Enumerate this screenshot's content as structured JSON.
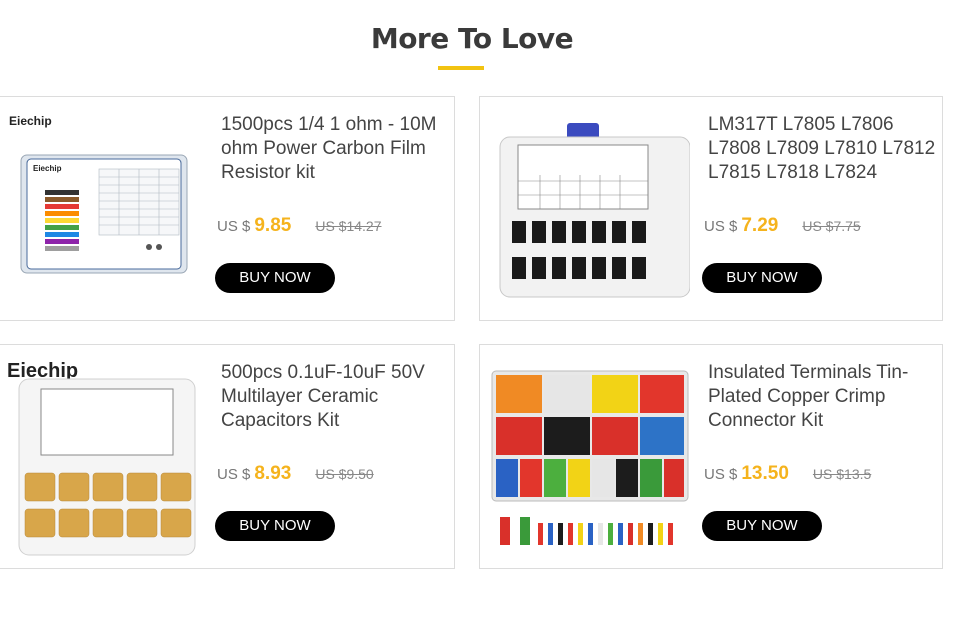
{
  "section": {
    "title": "More To Love",
    "accent": "#f2c311"
  },
  "products": [
    {
      "name": "1500pcs 1/4 1 ohm - 10M ohm Power Carbon Film Resistor kit",
      "currency": "US $",
      "price": "9.85",
      "old_price": "US $14.27",
      "button": "BUY NOW",
      "brand": "Eiechip"
    },
    {
      "name": "LM317T L7805 L7806 L7808 L7809 L7810 L7812 L7815 L7818 L7824",
      "currency": "US $",
      "price": "7.29",
      "old_price": "US $7.75",
      "button": "BUY NOW"
    },
    {
      "name": "500pcs 0.1uF-10uF 50V Multilayer Ceramic Capacitors Kit",
      "currency": "US $",
      "price": "8.93",
      "old_price": "US $9.50",
      "button": "BUY NOW",
      "brand": "Eiechip"
    },
    {
      "name": "Insulated Terminals Tin-Plated Copper Crimp Connector Kit",
      "currency": "US $",
      "price": "13.50",
      "old_price": "US $13.5",
      "button": "BUY NOW"
    }
  ]
}
